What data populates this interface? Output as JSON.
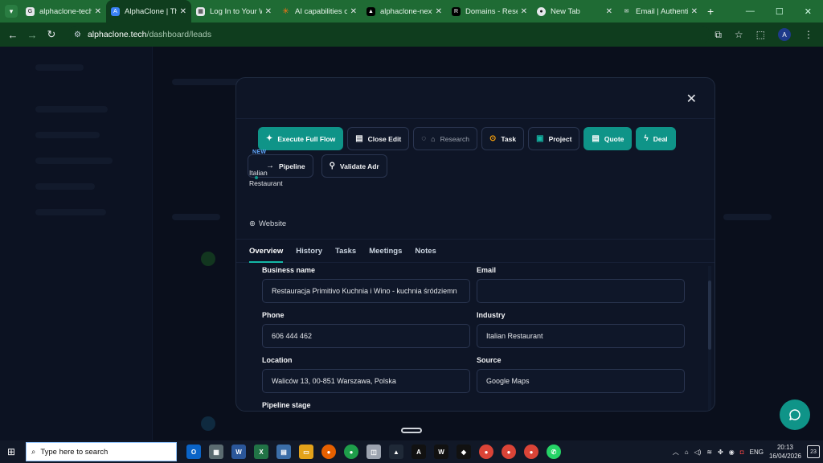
{
  "browser": {
    "tabs": [
      {
        "title": "alphaclone-tech",
        "icon": "google-icon",
        "active": false
      },
      {
        "title": "AlphaClone | The",
        "icon": "alphaclone-icon",
        "active": true
      },
      {
        "title": "Log In to Your W",
        "icon": "site-icon",
        "active": false
      },
      {
        "title": "AI capabilities o",
        "icon": "sparkle-icon",
        "active": false
      },
      {
        "title": "alphaclone-next",
        "icon": "vercel-icon",
        "active": false
      },
      {
        "title": "Domains - Resen",
        "icon": "domains-icon",
        "active": false
      },
      {
        "title": "New Tab",
        "icon": "chrome-icon",
        "active": false
      },
      {
        "title": "Email | Authentic",
        "icon": "email-icon",
        "active": false
      }
    ],
    "url_host": "alphaclone.tech",
    "url_path": "/dashboard/leads",
    "profile_initial": "A"
  },
  "modal": {
    "actions": [
      {
        "label": "Execute Full Flow",
        "icon": "sparkle-icon",
        "style": "teal"
      },
      {
        "label": "Close Edit",
        "icon": "document-icon",
        "style": "outline"
      },
      {
        "label": "Research",
        "icon": "spinner-icon",
        "style": "muted"
      },
      {
        "label": "Task",
        "icon": "check-circle-icon",
        "style": "outline"
      },
      {
        "label": "Project",
        "icon": "layout-icon",
        "style": "outline"
      },
      {
        "label": "Quote",
        "icon": "document-icon",
        "style": "teal"
      },
      {
        "label": "Deal",
        "icon": "bolt-icon",
        "style": "teal"
      }
    ],
    "new_badge": "NEW",
    "pipeline_label": "Pipeline",
    "validate_label": "Validate Adr",
    "tooltip_lines": [
      "Italian",
      "Restaurant"
    ],
    "website_label": "Website",
    "tabs": [
      "Overview",
      "History",
      "Tasks",
      "Meetings",
      "Notes"
    ],
    "fields": {
      "business_name": {
        "label": "Business name",
        "value": "Restauracja Primitivo Kuchnia i Wino - kuchnia śródziemn"
      },
      "email": {
        "label": "Email",
        "value": ""
      },
      "phone": {
        "label": "Phone",
        "value": "606 444 462"
      },
      "industry": {
        "label": "Industry",
        "value": "Italian Restaurant"
      },
      "location": {
        "label": "Location",
        "value": "Waliców 13, 00-851 Warszawa, Polska"
      },
      "source": {
        "label": "Source",
        "value": "Google Maps"
      },
      "pipeline_stage": {
        "label": "Pipeline stage"
      }
    }
  },
  "taskbar": {
    "search_placeholder": "Type here to search",
    "language": "ENG",
    "time": "20:13",
    "date": "16/04/2026",
    "notification_count": "23"
  },
  "colors": {
    "accent": "#0f9488",
    "browser_frame": "#1f6b34",
    "modal_bg": "#0e1526"
  }
}
